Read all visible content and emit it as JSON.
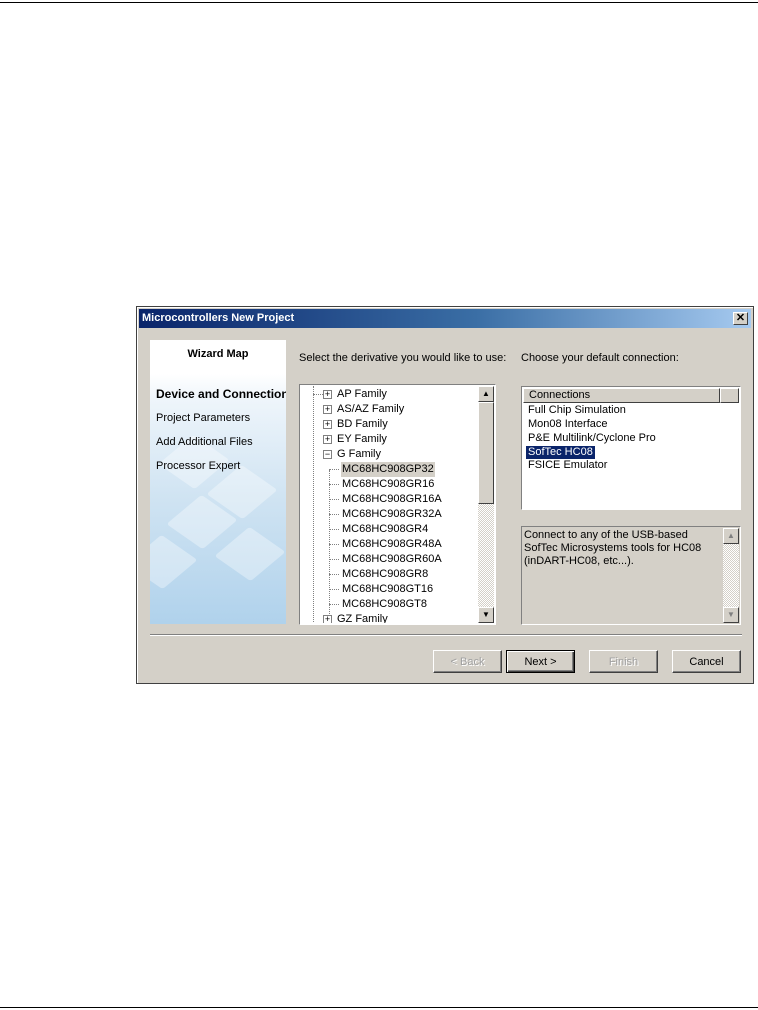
{
  "window": {
    "title": "Microcontrollers New Project",
    "close_glyph": "✕"
  },
  "wizard_map": {
    "title": "Wizard Map",
    "steps": [
      {
        "label": "Device and Connection",
        "active": true
      },
      {
        "label": "Project Parameters",
        "active": false
      },
      {
        "label": "Add Additional Files",
        "active": false
      },
      {
        "label": "Processor Expert",
        "active": false
      }
    ]
  },
  "derivative": {
    "prompt": "Select the derivative you would like to use:",
    "families": [
      {
        "label": "AP Family",
        "expanded": false
      },
      {
        "label": "AS/AZ Family",
        "expanded": false
      },
      {
        "label": "BD Family",
        "expanded": false
      },
      {
        "label": "EY Family",
        "expanded": false
      },
      {
        "label": "G Family",
        "expanded": true
      },
      {
        "label": "GZ Family",
        "expanded": false
      }
    ],
    "g_family_items": [
      "MC68HC908GP32",
      "MC68HC908GR16",
      "MC68HC908GR16A",
      "MC68HC908GR32A",
      "MC68HC908GR4",
      "MC68HC908GR48A",
      "MC68HC908GR60A",
      "MC68HC908GR8",
      "MC68HC908GT16",
      "MC68HC908GT8"
    ],
    "selected": "MC68HC908GP32",
    "scroll_up_glyph": "▲",
    "scroll_down_glyph": "▼"
  },
  "connection": {
    "prompt": "Choose your default connection:",
    "column_header": "Connections",
    "items": [
      "Full Chip Simulation",
      "Mon08 Interface",
      "P&E Multilink/Cyclone Pro",
      "SofTec HC08",
      "FSICE Emulator"
    ],
    "selected": "SofTec HC08",
    "description": "Connect to any of the USB-based SofTec Microsystems tools for HC08 (inDART-HC08, etc...)."
  },
  "buttons": {
    "back": "< Back",
    "next": "Next >",
    "finish": "Finish",
    "cancel": "Cancel"
  },
  "icons": {
    "expander_plus": "+",
    "expander_minus": "−"
  }
}
